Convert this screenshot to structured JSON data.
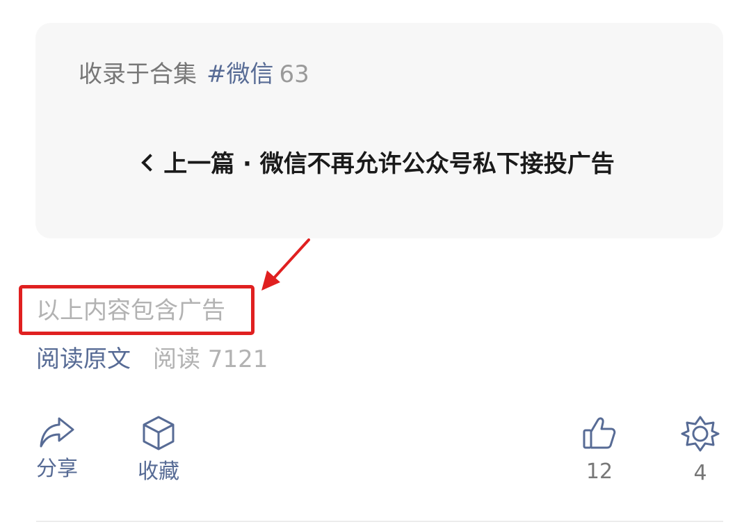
{
  "collection": {
    "prefix": "收录于合集",
    "tag": "#微信",
    "count": "63"
  },
  "prev_article": {
    "label": "上一篇 · 微信不再允许公众号私下接投广告",
    "icon": "chevron-left-icon"
  },
  "ad_notice": "以上内容包含广告",
  "meta": {
    "read_original": "阅读原文",
    "read_count": "阅读 7121"
  },
  "actions": {
    "share": {
      "label": "分享",
      "icon": "share-arrow-icon"
    },
    "favorite": {
      "label": "收藏",
      "icon": "cube-icon"
    },
    "like": {
      "count": "12",
      "icon": "thumbs-up-icon"
    },
    "wow": {
      "count": "4",
      "icon": "star-flower-icon"
    }
  },
  "colors": {
    "link": "#576b95",
    "muted": "#b2b2b2",
    "highlight": "#e02020",
    "card_bg": "#f7f7f7"
  }
}
